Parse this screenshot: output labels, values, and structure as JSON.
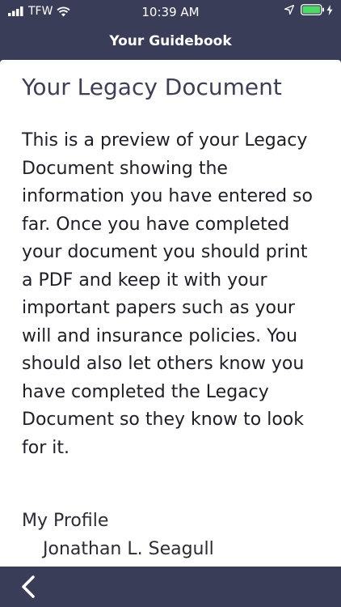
{
  "status_bar": {
    "carrier": "TFW",
    "time": "10:39 AM"
  },
  "nav": {
    "title": "Your Guidebook"
  },
  "main": {
    "title": "Your Legacy Document",
    "body": "This is a preview of your Legacy Document showing the information you have entered so far. Once you have completed your document you should print a PDF and keep it with your important papers such as your will and insurance policies. You should also let others know you have completed the Legacy Document so they know to look for it.",
    "profile_label": "My Profile",
    "profile_name": "Jonathan L. Seagull"
  },
  "icons": {
    "signal": "signal-bars-icon",
    "wifi": "wifi-icon",
    "location": "location-arrow-icon",
    "battery": "battery-icon",
    "charging": "charging-bolt-icon",
    "back": "chevron-left-icon"
  },
  "colors": {
    "bar_background": "#3a3d57",
    "battery_fill": "#4cd964"
  }
}
